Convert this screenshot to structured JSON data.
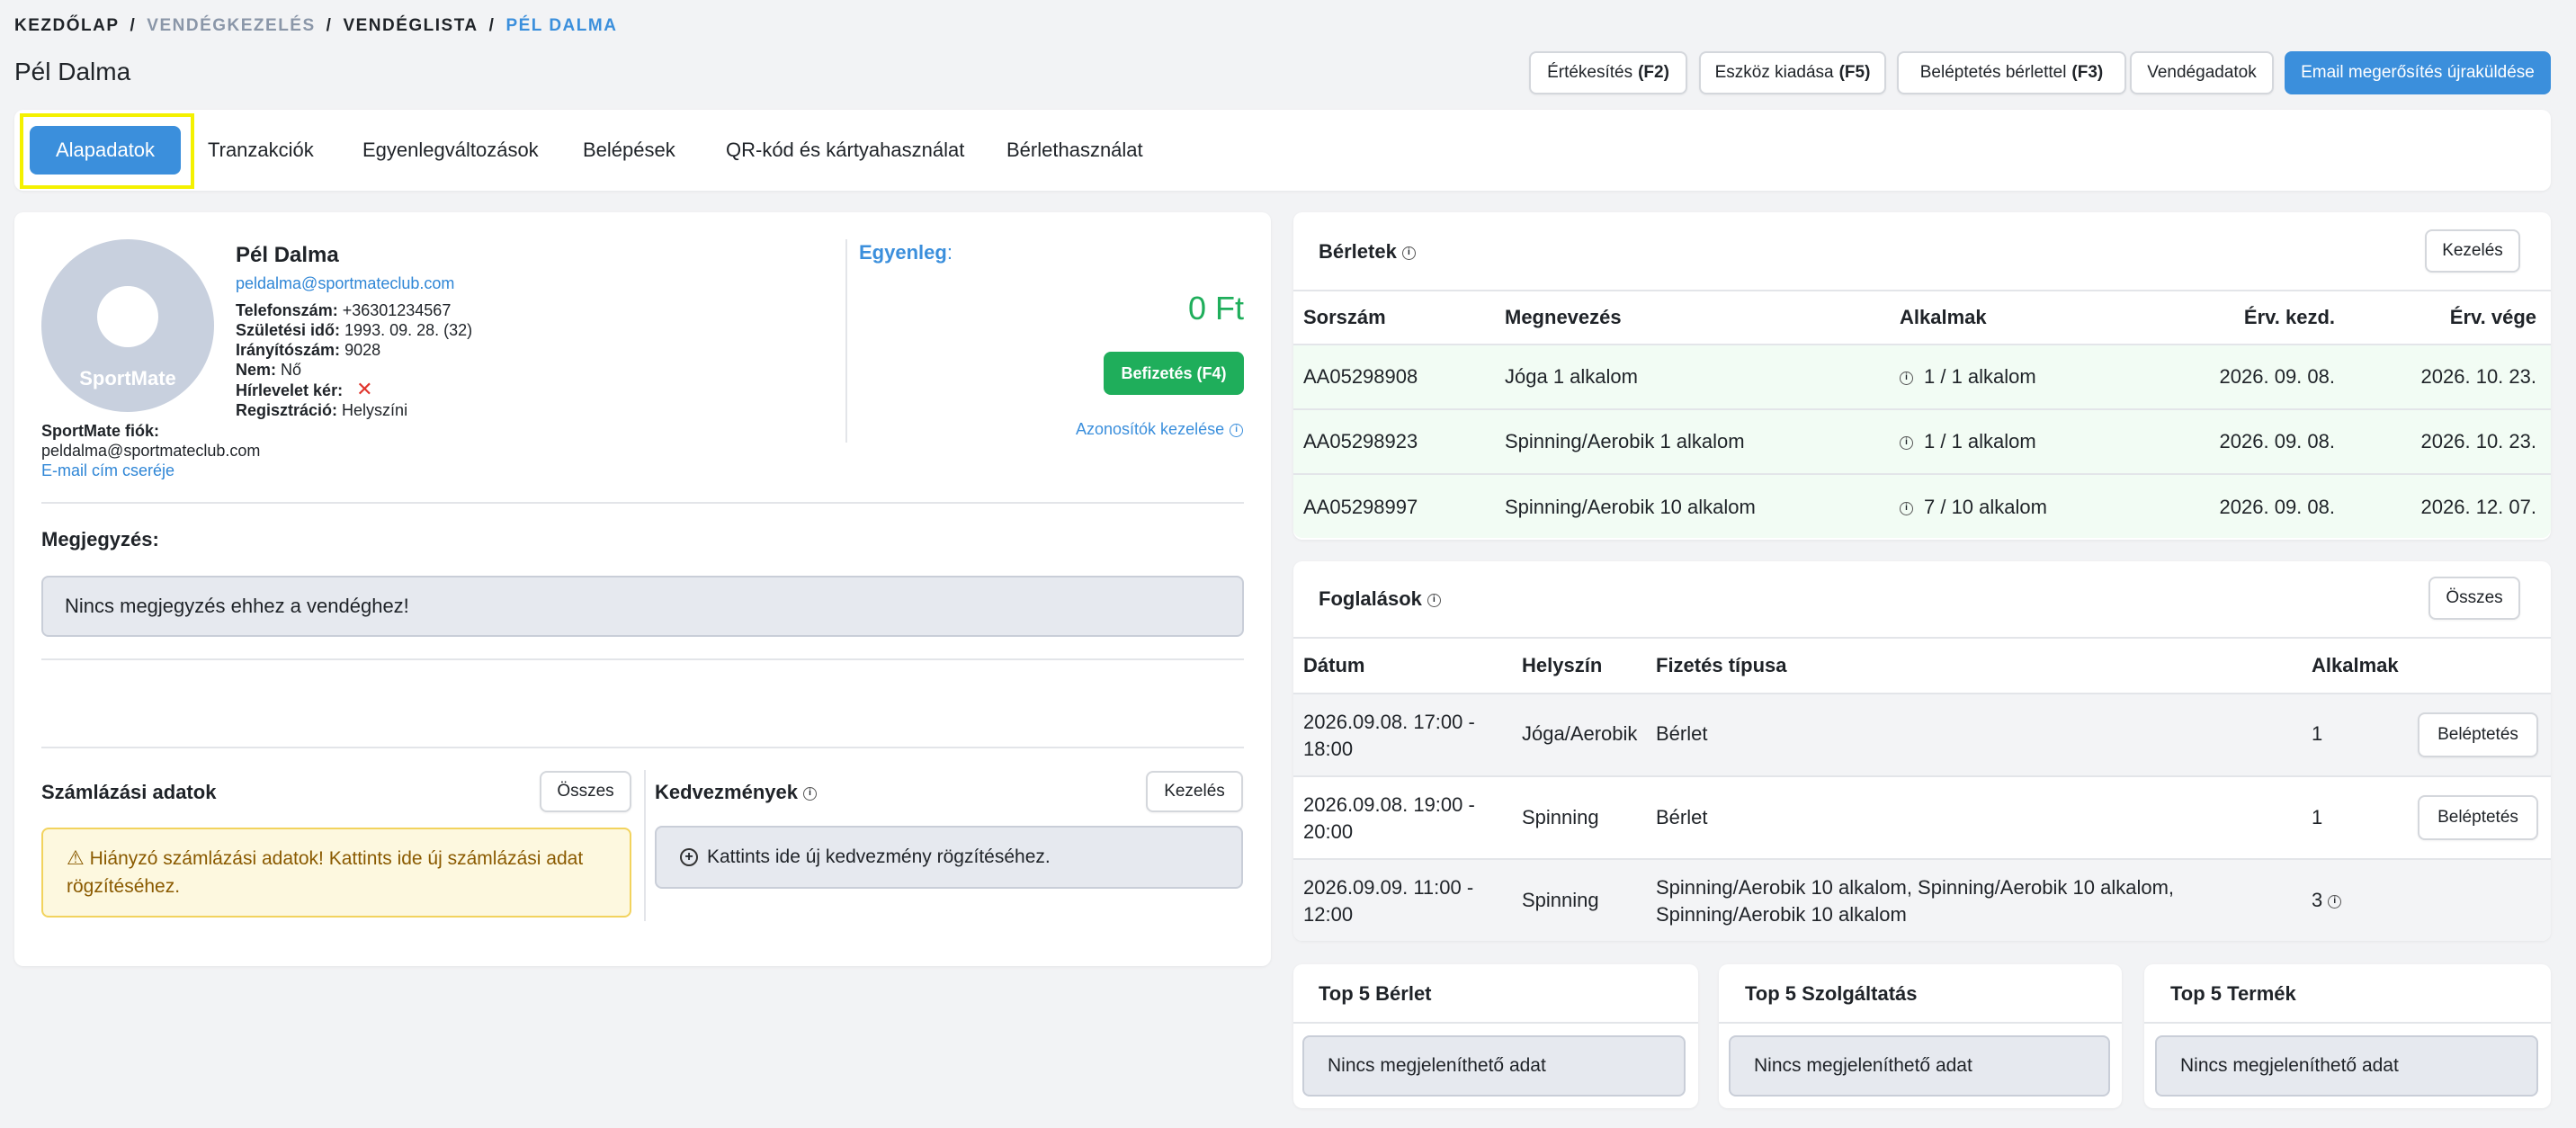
{
  "breadcrumb": {
    "home": "KEZDŐLAP",
    "sep": "/",
    "guest_mgmt": "VENDÉGKEZELÉS",
    "guest_list": "VENDÉGLISTA",
    "current": "PÉL DALMA"
  },
  "page_title": "Pél Dalma",
  "header_buttons": {
    "sales": {
      "label": "Értékesítés",
      "key": "(F2)"
    },
    "device": {
      "label": "Eszköz kiadása",
      "key": "(F5)"
    },
    "checkin_pass": {
      "label": "Beléptetés bérlettel",
      "key": "(F3)"
    },
    "guest_data": {
      "label": "Vendégadatok"
    },
    "resend_email": {
      "label": "Email megerősítés újraküldése"
    }
  },
  "tabs": [
    "Alapadatok",
    "Tranzakciók",
    "Egyenlegváltozások",
    "Belépések",
    "QR-kód és kártyahasználat",
    "Bérlethasználat"
  ],
  "profile": {
    "avatar_text": "SportMate",
    "name": "Pél Dalma",
    "email": "peldalma@sportmateclub.com",
    "phone_label": "Telefonszám:",
    "phone": "+36301234567",
    "birth_label": "Születési idő:",
    "birth": "1993. 09. 28. (32)",
    "zip_label": "Irányítószám:",
    "zip": "9028",
    "gender_label": "Nem:",
    "gender": "Nő",
    "newsletter_label": "Hírlevelet kér:",
    "reg_label": "Regisztráció:",
    "reg": "Helyszíni",
    "account_label": "SportMate fiók:",
    "account_email": "peldalma@sportmateclub.com",
    "change_email": "E-mail cím cseréje"
  },
  "balance": {
    "label": "Egyenleg",
    "colon": ":",
    "amount": "0 Ft",
    "pay_button": "Befizetés (F4)",
    "id_manage": "Azonosítók kezelése"
  },
  "note": {
    "label": "Megjegyzés:",
    "text": "Nincs megjegyzés ehhez a vendéghez!"
  },
  "billing": {
    "title": "Számlázási adatok",
    "all_button": "Összes",
    "warning": "Hiányzó számlázási adatok! Kattints ide új számlázási adat rögzítéséhez."
  },
  "discounts": {
    "title": "Kedvezmények",
    "manage_button": "Kezelés",
    "add_text": "Kattints ide új kedvezmény rögzítéséhez."
  },
  "passes": {
    "title": "Bérletek",
    "manage_button": "Kezelés",
    "columns": [
      "Sorszám",
      "Megnevezés",
      "Alkalmak",
      "Érv. kezd.",
      "Érv. vége"
    ],
    "rows": [
      {
        "id": "AA05298908",
        "name": "Jóga 1 alkalom",
        "uses": "1 / 1 alkalom",
        "start": "2026. 09. 08.",
        "end": "2026. 10. 23."
      },
      {
        "id": "AA05298923",
        "name": "Spinning/Aerobik 1 alkalom",
        "uses": "1 / 1 alkalom",
        "start": "2026. 09. 08.",
        "end": "2026. 10. 23."
      },
      {
        "id": "AA05298997",
        "name": "Spinning/Aerobik 10 alkalom",
        "uses": "7 / 10 alkalom",
        "start": "2026. 09. 08.",
        "end": "2026. 12. 07."
      }
    ]
  },
  "bookings": {
    "title": "Foglalások",
    "all_button": "Összes",
    "columns": [
      "Dátum",
      "Helyszín",
      "Fizetés típusa",
      "Alkalmak"
    ],
    "checkin_label": "Beléptetés",
    "rows": [
      {
        "date1": "2026.09.08. 17:00 -",
        "date2": "18:00",
        "place": "Jóga/Aerobik",
        "payment1": "Bérlet",
        "payment2": "",
        "count": "1"
      },
      {
        "date1": "2026.09.08. 19:00 -",
        "date2": "20:00",
        "place": "Spinning",
        "payment1": "Bérlet",
        "payment2": "",
        "count": "1"
      },
      {
        "date1": "2026.09.09. 11:00 -",
        "date2": "12:00",
        "place": "Spinning",
        "payment1": "Spinning/Aerobik 10 alkalom, Spinning/Aerobik 10 alkalom,",
        "payment2": "Spinning/Aerobik 10 alkalom",
        "count": "3"
      }
    ]
  },
  "top5": {
    "passes_title": "Top 5 Bérlet",
    "services_title": "Top 5 Szolgáltatás",
    "products_title": "Top 5 Termék",
    "empty": "Nincs megjeleníthető adat"
  },
  "colors": {
    "accent": "#3b8fdc",
    "green": "#1fae5b",
    "warning_bg": "#fdf8df",
    "warning_border": "#f2d35e",
    "highlight": "#f2fcf4"
  }
}
